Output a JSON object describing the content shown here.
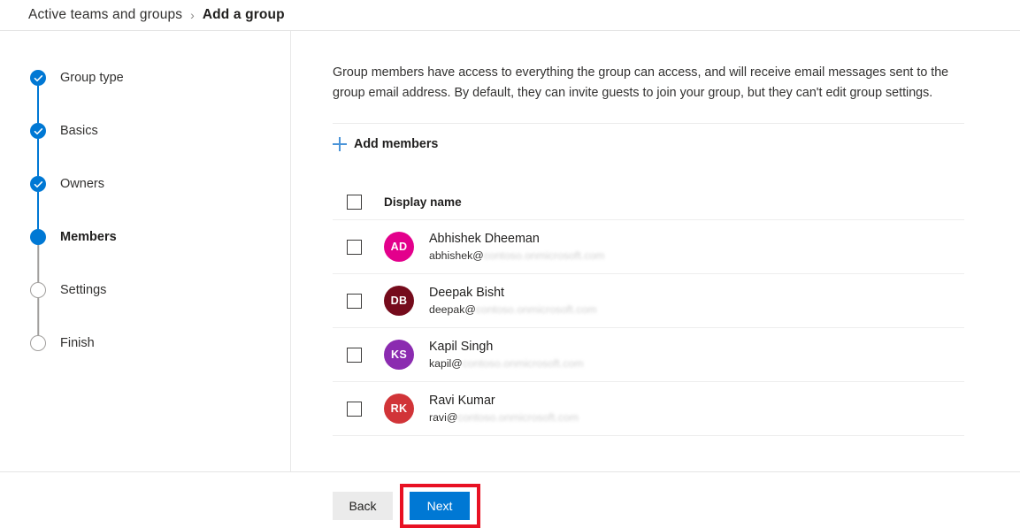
{
  "breadcrumb": {
    "parent": "Active teams and groups",
    "separator": "›",
    "current": "Add a group"
  },
  "sidebar": {
    "steps": [
      {
        "label": "Group type",
        "state": "done",
        "marker": "check-circle-icon"
      },
      {
        "label": "Basics",
        "state": "done",
        "marker": "check-circle-icon"
      },
      {
        "label": "Owners",
        "state": "done",
        "marker": "check-circle-icon"
      },
      {
        "label": "Members",
        "state": "current",
        "marker": "filled-circle-icon"
      },
      {
        "label": "Settings",
        "state": "todo",
        "marker": "empty-circle-icon"
      },
      {
        "label": "Finish",
        "state": "todo",
        "marker": "empty-circle-icon"
      }
    ]
  },
  "content": {
    "description": "Group members have access to everything the group can access, and will receive email messages sent to the group email address. By default, they can invite guests to join your group, but they can't edit group settings.",
    "add_members_label": "Add members",
    "add_members_icon": "plus-icon",
    "table": {
      "select_all_checked": false,
      "columns": [
        "Display name"
      ],
      "rows": [
        {
          "initials": "AD",
          "avatar_color": "#e3008c",
          "name": "Abhishek Dheeman",
          "email_visible": "abhishek@",
          "email_redacted": "contoso.onmicrosoft.com",
          "checked": false
        },
        {
          "initials": "DB",
          "avatar_color": "#750b1c",
          "name": "Deepak Bisht",
          "email_visible": "deepak@",
          "email_redacted": "contoso.onmicrosoft.com",
          "checked": false
        },
        {
          "initials": "KS",
          "avatar_color": "#8b2bb0",
          "name": "Kapil Singh",
          "email_visible": "kapil@",
          "email_redacted": "contoso.onmicrosoft.com",
          "checked": false
        },
        {
          "initials": "RK",
          "avatar_color": "#d13438",
          "name": "Ravi Kumar",
          "email_visible": "ravi@",
          "email_redacted": "contoso.onmicrosoft.com",
          "checked": false
        }
      ]
    }
  },
  "footer": {
    "back_label": "Back",
    "next_label": "Next"
  },
  "annotation": {
    "highlight_color": "#e81123",
    "target": "next-button"
  },
  "colors": {
    "accent": "#0078d4",
    "step_done": "#0078d4",
    "step_todo": "#a19f9d",
    "divider": "#e5e5e5"
  }
}
